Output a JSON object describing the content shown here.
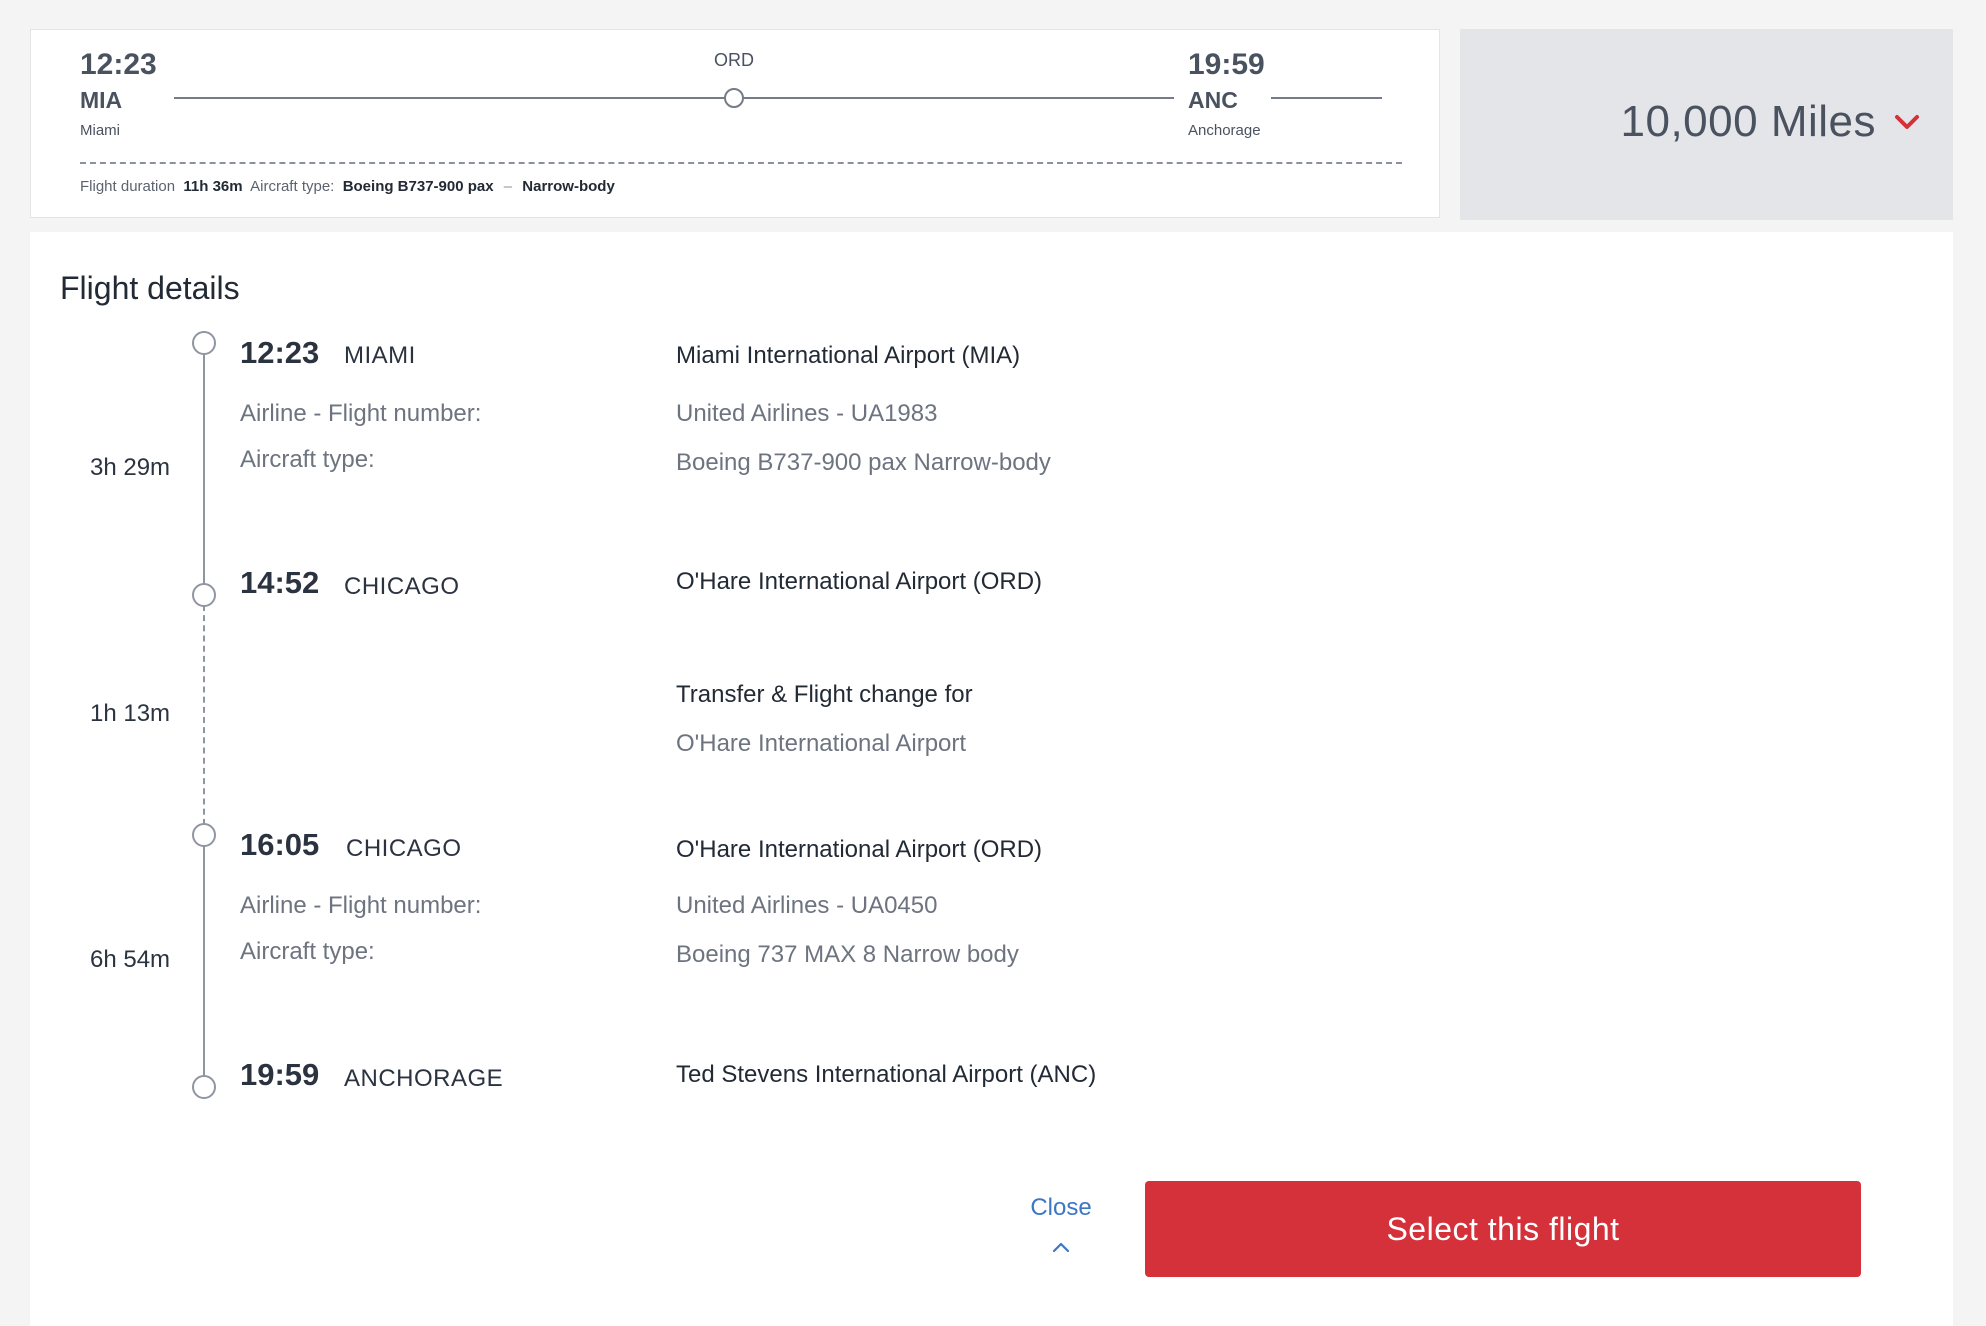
{
  "summary": {
    "departure": {
      "time": "12:23",
      "code": "MIA",
      "city": "Miami"
    },
    "stop": {
      "code": "ORD"
    },
    "arrival": {
      "time": "19:59",
      "code": "ANC",
      "city": "Anchorage"
    },
    "duration_label": "Flight duration",
    "duration_value": "11h 36m",
    "aircraft_label": "Aircraft type:",
    "aircraft_value": "Boeing B737-900 pax",
    "separator": "–",
    "body_type": "Narrow-body"
  },
  "price": {
    "label": "10,000 Miles",
    "accent_color": "#d5313a"
  },
  "details": {
    "title": "Flight details",
    "legs": [
      {
        "duration": "3h 29m",
        "depart_time": "12:23",
        "depart_city": "MIAMI",
        "depart_airport": "Miami International Airport (MIA)",
        "airline_label": "Airline - Flight number:",
        "airline_value": "United Airlines - UA1983",
        "aircraft_label": "Aircraft type:",
        "aircraft_value": "Boeing B737-900 pax Narrow-body",
        "arrive_time": "14:52",
        "arrive_city": "CHICAGO",
        "arrive_airport": "O'Hare International Airport (ORD)"
      },
      {
        "duration": "6h 54m",
        "depart_time": "16:05",
        "depart_city": "CHICAGO",
        "depart_airport": "O'Hare International Airport (ORD)",
        "airline_label": "Airline - Flight number:",
        "airline_value": "United Airlines - UA0450",
        "aircraft_label": "Aircraft type:",
        "aircraft_value": "Boeing 737 MAX 8 Narrow body",
        "arrive_time": "19:59",
        "arrive_city": "ANCHORAGE",
        "arrive_airport": "Ted Stevens International Airport (ANC)"
      }
    ],
    "transfer": {
      "duration": "1h 13m",
      "title": "Transfer & Flight change for",
      "airport": "O'Hare International Airport"
    }
  },
  "actions": {
    "close_label": "Close",
    "select_label": "Select this flight"
  }
}
